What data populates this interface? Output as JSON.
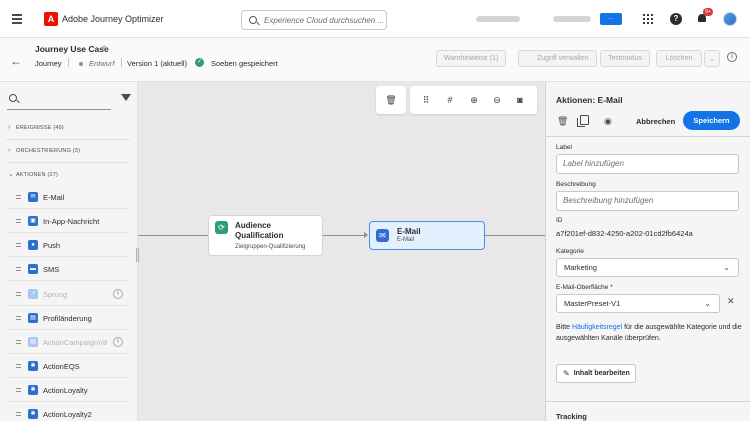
{
  "topbar": {
    "app_title": "Adobe Journey Optimizer",
    "search_placeholder": "Experience Cloud durchsuchen ...",
    "notification_count": "9+"
  },
  "journey": {
    "title": "Journey Use Case",
    "type": "Journey",
    "status": "Entwurf",
    "version": "Version 1 (aktuell)",
    "save_state": "Soeben gespeichert",
    "buttons": {
      "warnings": "Warnhinweise (1)",
      "access": "Zugriff verwalten",
      "test": "Testmodus",
      "delete": "Löschen"
    }
  },
  "palette": {
    "categories": [
      {
        "label": "EREIGNISSE (49)",
        "expanded": false
      },
      {
        "label": "ORCHESTRIERUNG (3)",
        "expanded": false
      },
      {
        "label": "AKTIONEN (27)",
        "expanded": true
      }
    ],
    "actions": [
      {
        "label": "E-Mail",
        "icon": "email-icon",
        "enabled": true
      },
      {
        "label": "In-App-Nachricht",
        "icon": "in-app-icon",
        "enabled": true
      },
      {
        "label": "Push",
        "icon": "push-icon",
        "enabled": true
      },
      {
        "label": "SMS",
        "icon": "sms-icon",
        "enabled": true
      },
      {
        "label": "Sprung",
        "icon": "jump-icon",
        "enabled": false
      },
      {
        "label": "Profiländerung",
        "icon": "profile-update-icon",
        "enabled": true
      },
      {
        "label": "ActionCampaignV8",
        "icon": "campaign-action-icon",
        "enabled": false
      },
      {
        "label": "ActionEQS",
        "icon": "custom-action-icon",
        "enabled": true
      },
      {
        "label": "ActionLoyalty",
        "icon": "custom-action-icon",
        "enabled": true
      },
      {
        "label": "ActionLoyalty2",
        "icon": "custom-action-icon",
        "enabled": true
      }
    ]
  },
  "canvas": {
    "nodes": [
      {
        "title": "Audience Qualification",
        "subtitle": "Zielgruppen-Qualifizierung",
        "icon": "audience-qualification-icon"
      },
      {
        "title": "E-Mail",
        "subtitle": "E-Mail",
        "icon": "email-icon",
        "selected": true
      }
    ]
  },
  "panel": {
    "title": "Aktionen: E-Mail",
    "cancel_label": "Abbrechen",
    "save_label": "Speichern",
    "label_field": {
      "label": "Label",
      "placeholder": "Label hinzufügen"
    },
    "description_field": {
      "label": "Beschreibung",
      "placeholder": "Beschreibung hinzufügen"
    },
    "id_label": "ID",
    "id_value": "a7f201ef-d832-4250-a202-01cd2fb6424a",
    "category_label": "Kategorie",
    "category_value": "Marketing",
    "surface_label": "E-Mail-Oberfläche",
    "surface_value": "MasterPreset-V1",
    "info_pre": "Bitte ",
    "info_link": "Häufigkeitsregel",
    "info_post": " für die ausgewählte Kategorie und die ausgewählten Kanäle überprüfen.",
    "edit_content_label": "Inhalt bearbeiten",
    "tracking_label": "Tracking"
  },
  "colors": {
    "accent": "#1473e6",
    "success": "#2d9d78",
    "selected_node_bg": "#e5f0fe"
  }
}
